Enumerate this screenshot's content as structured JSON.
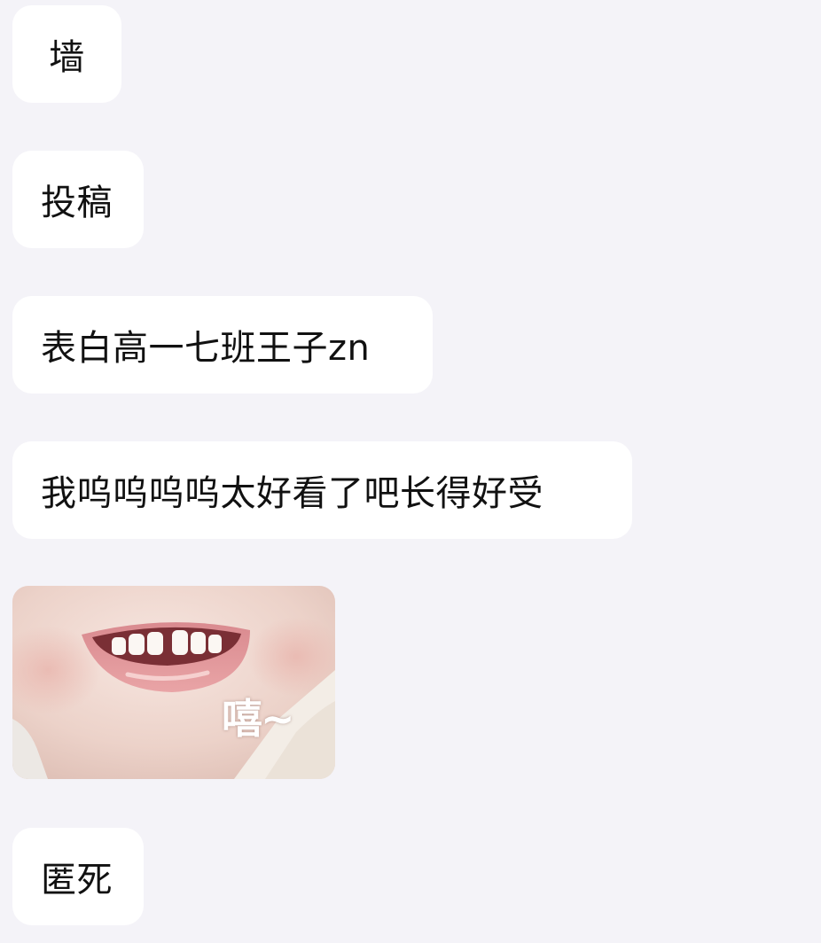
{
  "chat": {
    "messages": [
      {
        "type": "text",
        "text": "墙"
      },
      {
        "type": "text",
        "text": "投稿"
      },
      {
        "type": "text",
        "text": "表白高一七班王子zn"
      },
      {
        "type": "text",
        "text": "我呜呜呜呜太好看了吧长得好受"
      },
      {
        "type": "sticker",
        "caption": "嘻~",
        "icon": "smiling-child-mouth-sticker"
      },
      {
        "type": "text",
        "text": "匿死"
      }
    ]
  },
  "colors": {
    "background": "#f4f3f8",
    "bubble": "#ffffff",
    "text": "#111111"
  }
}
